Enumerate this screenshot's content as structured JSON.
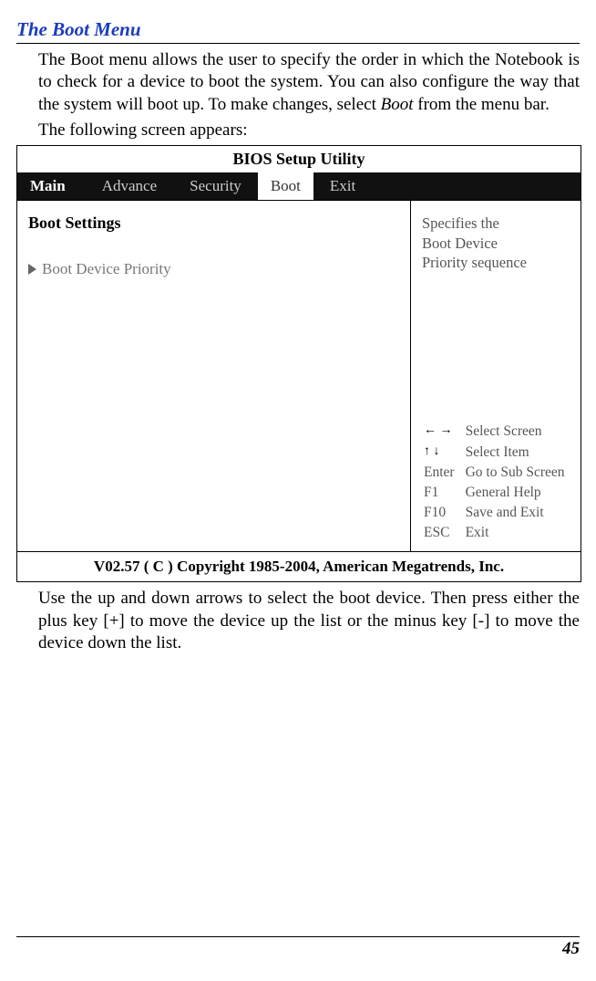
{
  "section_title": "The Boot Menu",
  "para1_a": "The Boot menu allows the user to specify the order in which the Notebook is to check for a device to boot the system.  You can also configure the way that the system will boot up.  To make changes, select ",
  "para1_b": "Boot",
  "para1_c": " from the menu bar.",
  "para2": "The following screen appears:",
  "bios": {
    "title": "BIOS Setup Utility",
    "tabs": {
      "main": "Main",
      "advance": "Advance",
      "security": "Security",
      "boot": "Boot",
      "exit": "Exit"
    },
    "left": {
      "heading": "Boot Settings",
      "item": "Boot Device Priority"
    },
    "right": {
      "help_line1": "Specifies the",
      "help_line2": "Boot Device",
      "help_line3": "Priority sequence",
      "keys": {
        "k1": "← →",
        "v1": "Select Screen",
        "k2": "↑ ↓",
        "v2": "Select Item",
        "k3": "Enter",
        "v3": "Go to Sub Screen",
        "k4": "F1",
        "v4": "General Help",
        "k5": "F10",
        "v5": "Save and Exit",
        "k6": "ESC",
        "v6": "Exit"
      }
    },
    "footer": "V02.57  ( C ) Copyright 1985-2004, American Megatrends, Inc."
  },
  "para3": "Use the up and down arrows to select the boot device.  Then press either the plus key [+] to move the device up the list or the minus key [-] to move the device down the list.",
  "page_number": "45"
}
